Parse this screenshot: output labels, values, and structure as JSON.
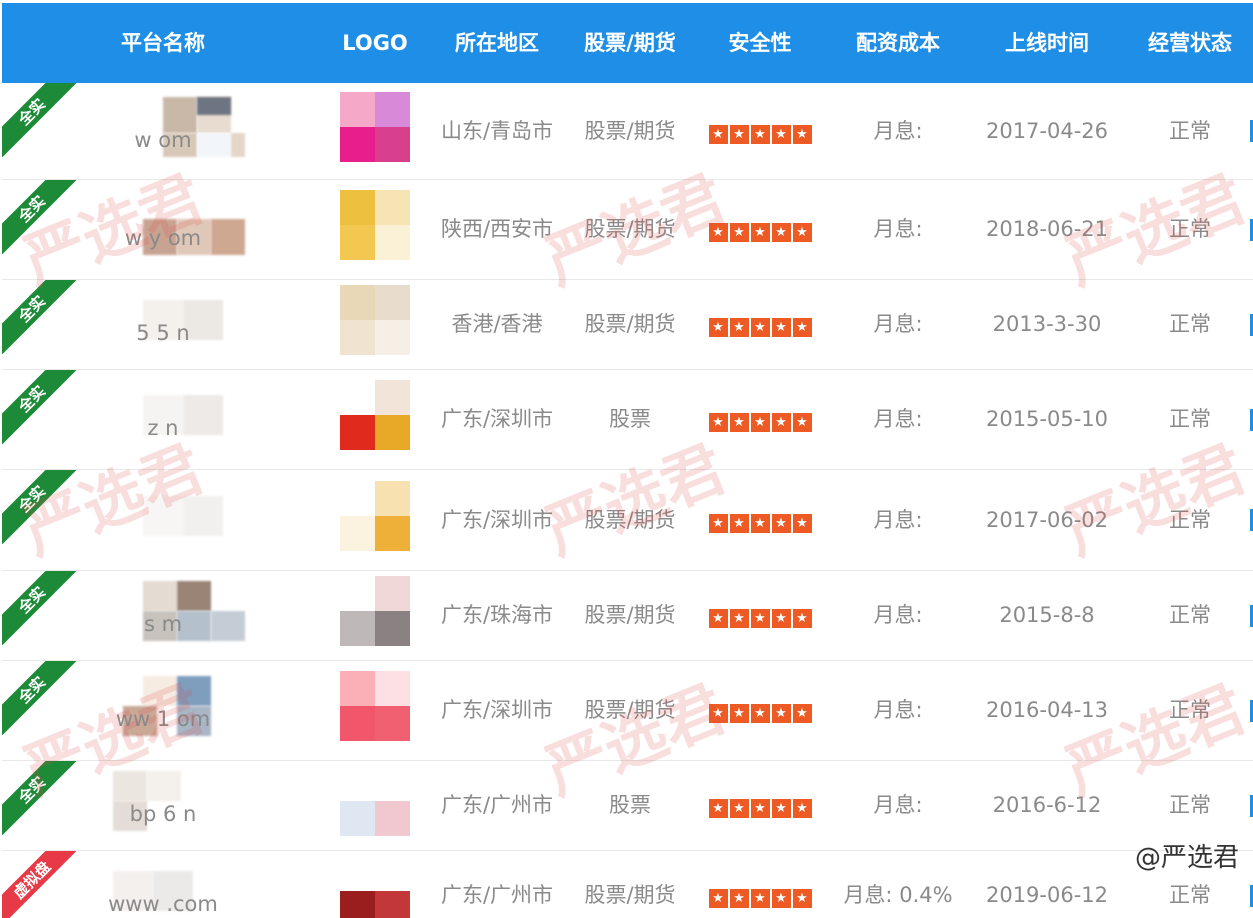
{
  "headers": [
    "平台名称",
    "LOGO",
    "所在地区",
    "股票/期货",
    "安全性",
    "配资成本",
    "上线时间",
    "经营状态"
  ],
  "rows": [
    {
      "badge": "全实",
      "badge_color": "#1d8a38",
      "site": "w           om",
      "region": "山东/青岛市",
      "type": "股票/期货",
      "cost": "月息:",
      "date": "2017-04-26",
      "status": "正常"
    },
    {
      "badge": "全实",
      "badge_color": "#1d8a38",
      "site": "w     y       om",
      "region": "陕西/西安市",
      "type": "股票/期货",
      "cost": "月息:",
      "date": "2018-06-21",
      "status": "正常"
    },
    {
      "badge": "全实",
      "badge_color": "#1d8a38",
      "site": "5     5     n",
      "region": "香港/香港",
      "type": "股票/期货",
      "cost": "月息:",
      "date": "2013-3-30",
      "status": "正常"
    },
    {
      "badge": "全实",
      "badge_color": "#1d8a38",
      "site": "z     n",
      "region": "广东/深圳市",
      "type": "股票",
      "cost": "月息:",
      "date": "2015-05-10",
      "status": "正常"
    },
    {
      "badge": "全实",
      "badge_color": "#1d8a38",
      "site": "",
      "region": "广东/深圳市",
      "type": "股票/期货",
      "cost": "月息:",
      "date": "2017-06-02",
      "status": "正常"
    },
    {
      "badge": "全实",
      "badge_color": "#1d8a38",
      "site": "s           m",
      "region": "广东/珠海市",
      "type": "股票/期货",
      "cost": "月息:",
      "date": "2015-8-8",
      "status": "正常"
    },
    {
      "badge": "全实",
      "badge_color": "#1d8a38",
      "site": "ww        1      om",
      "region": "广东/深圳市",
      "type": "股票/期货",
      "cost": "月息:",
      "date": "2016-04-13",
      "status": "正常"
    },
    {
      "badge": "全实",
      "badge_color": "#1d8a38",
      "site": "bp       6     n",
      "region": "广东/广州市",
      "type": "股票",
      "cost": "月息:",
      "date": "2016-6-12",
      "status": "正常"
    },
    {
      "badge": "虚拟盘",
      "badge_color": "#e83a46",
      "site": "www         .com",
      "region": "广东/广州市",
      "type": "股票/期货",
      "cost": "月息: 0.4%",
      "date": "2019-06-12",
      "status": "正常"
    }
  ],
  "rating_stars": 5,
  "watermark": "严选君",
  "credit": "@严选君",
  "colors": {
    "header_bg": "#1e8ee6",
    "star": "#ee5a24",
    "badge_green": "#1d8a38",
    "badge_red": "#e83a46"
  }
}
